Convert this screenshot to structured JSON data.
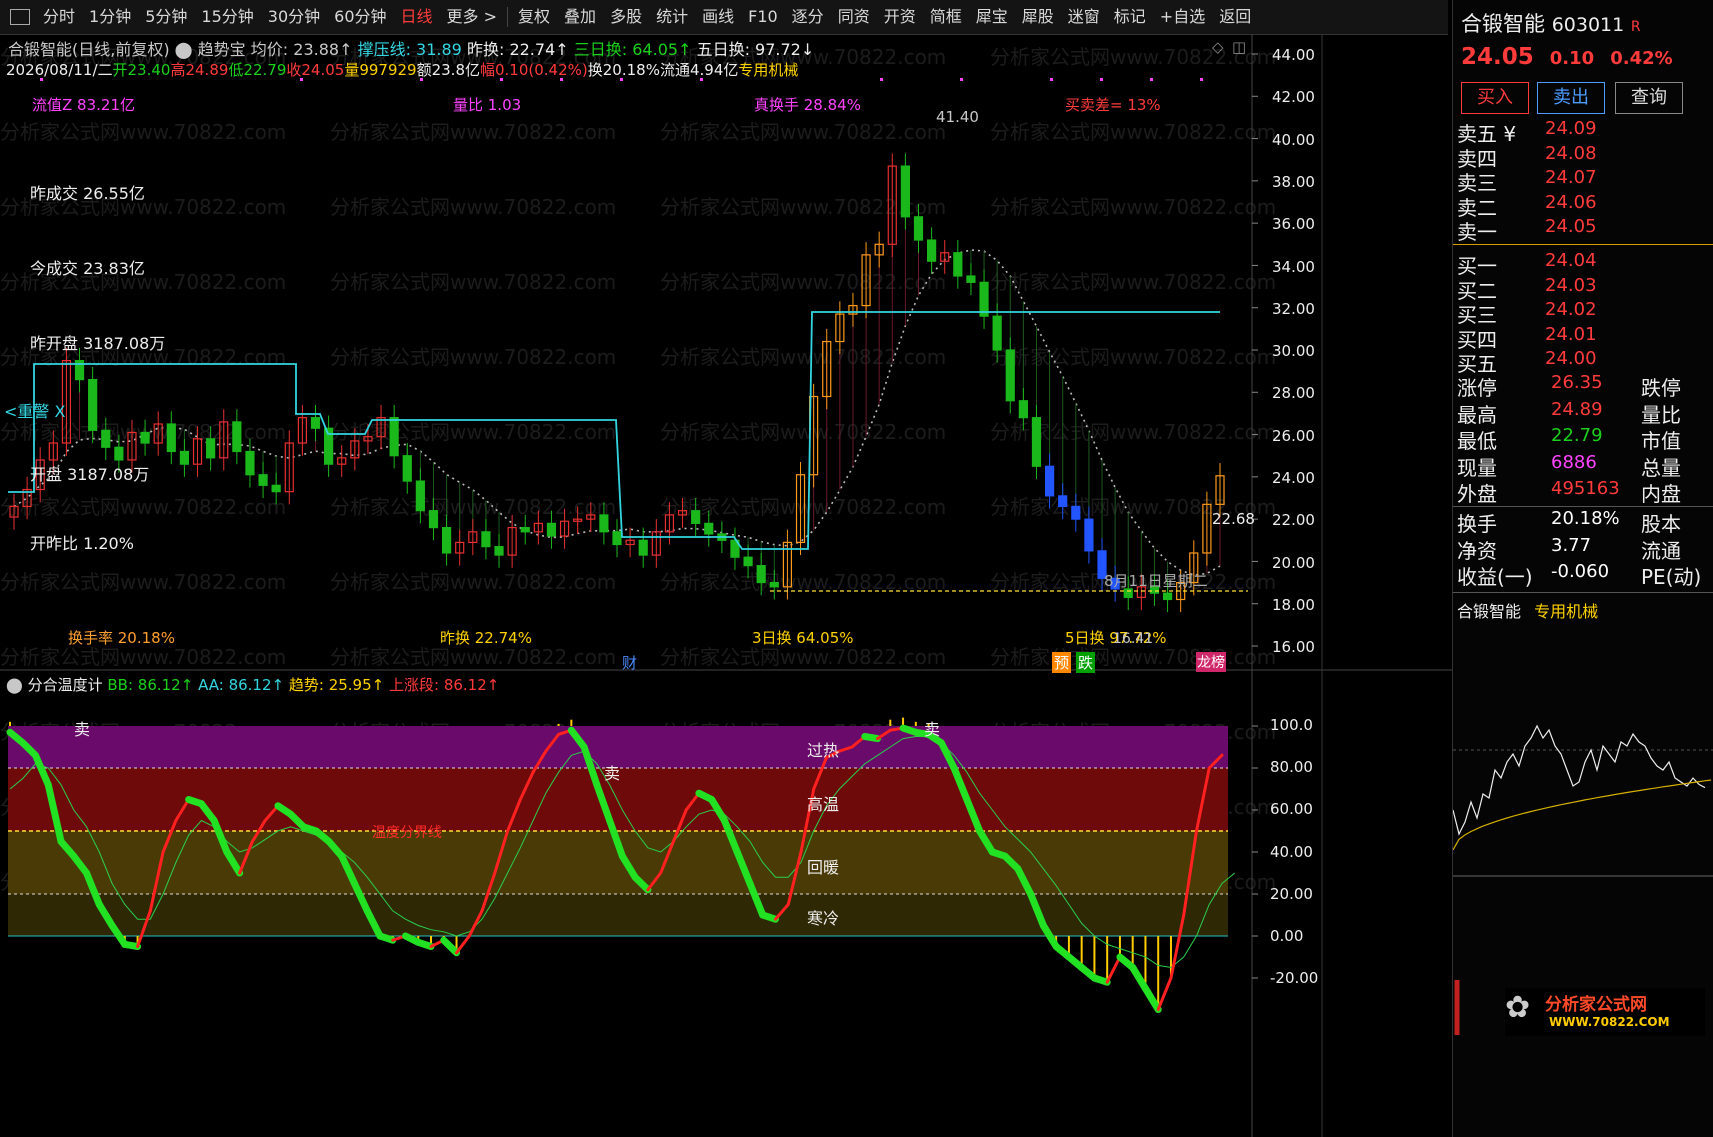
{
  "toolbar": {
    "items": [
      {
        "label": "分时",
        "active": false
      },
      {
        "label": "1分钟",
        "active": false
      },
      {
        "label": "5分钟",
        "active": false
      },
      {
        "label": "15分钟",
        "active": false
      },
      {
        "label": "30分钟",
        "active": false
      },
      {
        "label": "60分钟",
        "active": false
      },
      {
        "label": "日线",
        "active": true
      },
      {
        "label": "更多 >",
        "active": false
      },
      {
        "label": "复权",
        "active": false
      },
      {
        "label": "叠加",
        "active": false
      },
      {
        "label": "多股",
        "active": false
      },
      {
        "label": "统计",
        "active": false
      },
      {
        "label": "画线",
        "active": false
      },
      {
        "label": "F10",
        "active": false
      },
      {
        "label": "逐分",
        "active": false
      },
      {
        "label": "同资",
        "active": false
      },
      {
        "label": "开资",
        "active": false
      },
      {
        "label": "简框",
        "active": false
      },
      {
        "label": "犀宝",
        "active": false
      },
      {
        "label": "犀股",
        "active": false
      },
      {
        "label": "迷窗",
        "active": false
      },
      {
        "label": "标记",
        "active": false
      },
      {
        "label": "+自选",
        "active": false
      },
      {
        "label": "返回",
        "active": false
      }
    ]
  },
  "header": {
    "stock_mode": "合锻智能(日线,前复权)",
    "indicator": "趋势宝",
    "avg_label": "均价: 23.88↑",
    "pressure_label": "撑压线: 31.89",
    "prev_turn": "昨换: 22.74↑",
    "turn3": "三日换: 64.05↑",
    "turn5": "五日换: 97.72↓",
    "date": "2026/08/11/二",
    "open": "开23.40",
    "high": "高24.89",
    "low": "低22.79",
    "close": "收24.05",
    "volume": "量997929",
    "amount": "额23.8亿",
    "change": "幅0.10(0.42%)",
    "turnover": "换20.18%",
    "float": "流通4.94亿",
    "sector": "专用机械"
  },
  "overlay": {
    "mktcap": "流值Z 83.21亿",
    "vol_ratio": "量比 1.03",
    "real_turn": "真换手 28.84%",
    "bid_diff": "买卖差= 13%",
    "prev_amount": "昨成交 26.55亿",
    "today_amount": "今成交 23.83亿",
    "prev_open": "昨开盘 3187.08万",
    "warn": "<重警 X",
    "open_amount": "开盘 3187.08万",
    "open_ratio": "开昨比 1.20%",
    "turn_rate": "换手率 20.18%",
    "prev_turn2": "昨换 22.74%",
    "turn3b": "3日换 64.05%",
    "turn5b": "5日换 97.72%",
    "peak_label": "41.40",
    "low_label": "16.41",
    "date_mark": "8月11日星期二",
    "price_tag": "22.68",
    "tag_cai": "财",
    "tag_yu": "预",
    "tag_die": "跌",
    "tag_bang": "龙榜",
    "watermark": "分析家公式网www.70822.com"
  },
  "price_axis": [
    "44.00",
    "42.00",
    "40.00",
    "38.00",
    "36.00",
    "34.00",
    "32.00",
    "30.00",
    "28.00",
    "26.00",
    "24.00",
    "22.00",
    "20.00",
    "18.00",
    "16.00"
  ],
  "lower": {
    "title": "分合温度计",
    "bb": "BB: 86.12↑",
    "aa": "AA: 86.12↑",
    "trend": "趋势: 25.95↑",
    "up_phase": "上涨段: 86.12↑",
    "zones": [
      "过热",
      "高温",
      "回暖",
      "寒冷"
    ],
    "sell": "卖",
    "mid_label": "温度分界线",
    "axis": [
      "100.0",
      "80.00",
      "60.00",
      "40.00",
      "20.00",
      "0.00",
      "-20.00"
    ]
  },
  "right": {
    "name": "合锻智能",
    "code": "603011",
    "r_badge": "R",
    "price": "24.05",
    "chg": "0.10",
    "pct": "0.42%",
    "buttons": [
      "买入",
      "卖出",
      "查询"
    ],
    "asks": [
      [
        "卖五 ¥",
        "24.09"
      ],
      [
        "卖四",
        "24.08"
      ],
      [
        "卖三",
        "24.07"
      ],
      [
        "卖二",
        "24.06"
      ],
      [
        "卖一",
        "24.05"
      ]
    ],
    "bids": [
      [
        "买一",
        "24.04"
      ],
      [
        "买二",
        "24.03"
      ],
      [
        "买三",
        "24.02"
      ],
      [
        "买四",
        "24.01"
      ],
      [
        "买五",
        "24.00"
      ]
    ],
    "stats": [
      [
        "涨停",
        "26.35",
        "跌停"
      ],
      [
        "最高",
        "24.89",
        "量比"
      ],
      [
        "最低",
        "22.79",
        "市值"
      ],
      [
        "现量",
        "6886",
        "总量"
      ],
      [
        "外盘",
        "495163",
        "内盘"
      ]
    ],
    "stats2": [
      [
        "换手",
        "20.18%",
        "股本"
      ],
      [
        "净资",
        "3.77",
        "流通"
      ],
      [
        "收益(一)",
        "-0.060",
        "PE(动)"
      ]
    ],
    "footer_name": "合锻智能",
    "footer_sector": "专用机械",
    "brand": "分析家公式网",
    "brand_url": "WWW.70822.COM"
  },
  "chart_data": [
    {
      "type": "candlestick",
      "title": "合锻智能(日线,前复权)",
      "ylim": [
        16,
        44
      ],
      "y_ticks": [
        16,
        18,
        20,
        22,
        24,
        26,
        28,
        30,
        32,
        34,
        36,
        38,
        40,
        42,
        44
      ],
      "close_series": [
        22.6,
        23.4,
        24.8,
        25.6,
        29.5,
        28.6,
        26.2,
        25.4,
        24.8,
        26.1,
        25.6,
        26.5,
        25.2,
        24.6,
        25.8,
        24.9,
        26.6,
        25.2,
        24.1,
        23.6,
        23.3,
        25.6,
        26.8,
        26.3,
        24.6,
        24.9,
        25.7,
        25.9,
        26.8,
        25.0,
        23.8,
        22.4,
        21.6,
        20.4,
        20.9,
        21.4,
        20.7,
        20.3,
        21.6,
        21.4,
        21.8,
        21.2,
        21.9,
        22.0,
        22.2,
        21.4,
        20.8,
        21.0,
        20.3,
        21.4,
        22.2,
        22.4,
        21.8,
        21.3,
        21.0,
        20.2,
        19.8,
        19.0,
        18.8,
        20.9,
        24.1,
        27.8,
        30.4,
        31.7,
        32.1,
        34.5,
        35.0,
        38.7,
        36.3,
        35.2,
        34.2,
        34.6,
        33.5,
        33.2,
        31.6,
        30.0,
        27.6,
        26.8,
        24.5,
        23.1,
        22.6,
        22.0,
        20.5,
        19.2,
        18.7,
        18.3,
        18.8,
        18.5,
        18.2,
        19.0,
        20.4,
        22.7,
        24.05
      ],
      "peak": 41.4,
      "low": 16.41
    },
    {
      "type": "line",
      "title": "分合温度计",
      "ylim": [
        -20,
        100
      ],
      "y_ticks": [
        -20,
        0,
        20,
        40,
        60,
        80,
        100
      ],
      "series": [
        {
          "name": "BB",
          "values": [
            97,
            92,
            86,
            72,
            45,
            38,
            30,
            15,
            5,
            -4,
            -5,
            12,
            40,
            55,
            65,
            63,
            55,
            40,
            30,
            45,
            55,
            62,
            58,
            52,
            50,
            45,
            38,
            25,
            12,
            0,
            -2,
            0,
            -3,
            -5,
            -2,
            -8,
            0,
            12,
            30,
            50,
            65,
            78,
            88,
            96,
            98,
            90,
            72,
            55,
            38,
            28,
            22,
            30,
            45,
            60,
            68,
            65,
            55,
            40,
            25,
            10,
            8,
            15,
            40,
            70,
            85,
            88,
            90,
            95,
            94,
            98,
            99,
            97,
            96,
            92,
            80,
            65,
            50,
            40,
            38,
            32,
            20,
            5,
            -5,
            -10,
            -15,
            -20,
            -22,
            -10,
            -15,
            -25,
            -35,
            -20,
            10,
            50,
            80,
            86.12
          ]
        },
        {
          "name": "AA",
          "values": [
            70,
            75,
            82,
            80,
            72,
            60,
            52,
            40,
            25,
            15,
            8,
            8,
            20,
            35,
            48,
            55,
            52,
            45,
            40,
            42,
            46,
            50,
            52,
            50,
            48,
            44,
            40,
            35,
            28,
            20,
            12,
            8,
            5,
            3,
            2,
            0,
            2,
            8,
            18,
            30,
            42,
            55,
            68,
            78,
            86,
            88,
            82,
            72,
            60,
            50,
            42,
            40,
            45,
            52,
            58,
            60,
            58,
            52,
            45,
            35,
            28,
            28,
            35,
            50,
            62,
            70,
            76,
            82,
            86,
            90,
            94,
            95,
            95,
            92,
            86,
            78,
            68,
            60,
            52,
            46,
            40,
            32,
            24,
            15,
            6,
            0,
            -4,
            -6,
            -8,
            -10,
            -14,
            -15,
            -10,
            0,
            15,
            25,
            30
          ]
        }
      ]
    }
  ]
}
